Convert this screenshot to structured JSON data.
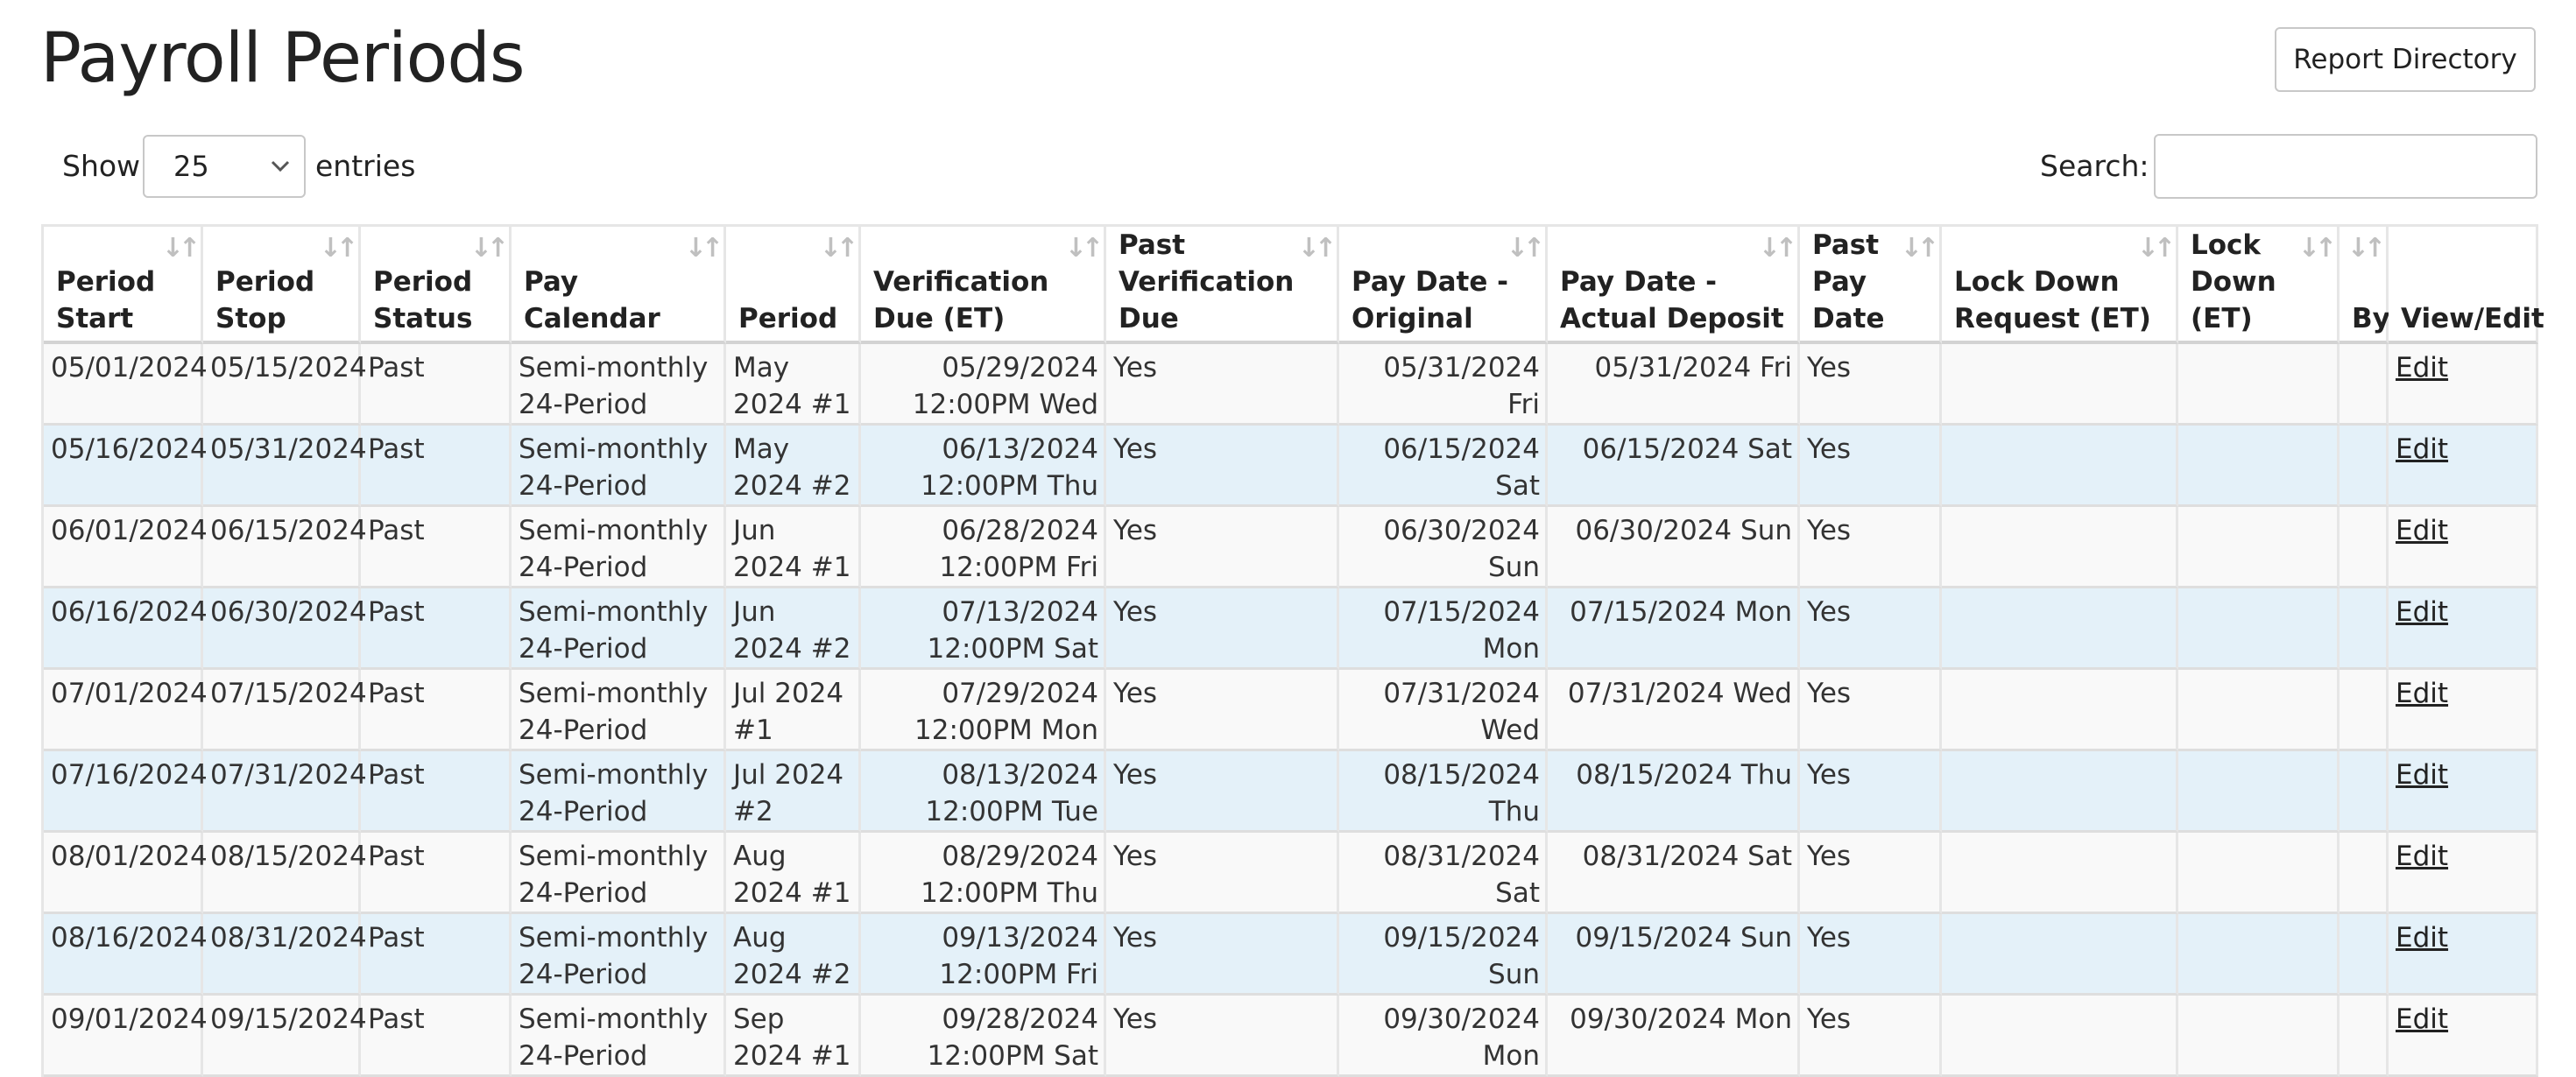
{
  "page": {
    "title": "Payroll Periods",
    "report_button": "Report Directory"
  },
  "length_menu": {
    "show": "Show",
    "value": "25",
    "entries": "entries"
  },
  "search": {
    "label": "Search:",
    "value": ""
  },
  "columns": [
    "Period Start",
    "Period Stop",
    "Period Status",
    "Pay Calendar",
    "Period",
    "Verification Due (ET)",
    "Past Verification Due",
    "Pay Date - Original",
    "Pay Date - Actual Deposit",
    "Past Pay Date",
    "Lock Down Request (ET)",
    "Lock Down (ET)",
    "By",
    "View/Edit"
  ],
  "rows": [
    {
      "start": "05/01/2024",
      "stop": "05/15/2024",
      "status": "Past",
      "calendar": "Semi-monthly 24-Period",
      "period": "May 2024 #1",
      "verify_date": "05/29/2024",
      "verify_time": "12:00PM Wed",
      "past_verify": "Yes",
      "pay_orig": "05/31/2024 Fri",
      "pay_actual": "05/31/2024 Fri",
      "past_pay": "Yes",
      "lock_req": "",
      "lock": "",
      "by": "",
      "action": "Edit"
    },
    {
      "start": "05/16/2024",
      "stop": "05/31/2024",
      "status": "Past",
      "calendar": "Semi-monthly 24-Period",
      "period": "May 2024 #2",
      "verify_date": "06/13/2024",
      "verify_time": "12:00PM Thu",
      "past_verify": "Yes",
      "pay_orig": "06/15/2024 Sat",
      "pay_actual": "06/15/2024 Sat",
      "past_pay": "Yes",
      "lock_req": "",
      "lock": "",
      "by": "",
      "action": "Edit"
    },
    {
      "start": "06/01/2024",
      "stop": "06/15/2024",
      "status": "Past",
      "calendar": "Semi-monthly 24-Period",
      "period": "Jun 2024 #1",
      "verify_date": "06/28/2024",
      "verify_time": "12:00PM Fri",
      "past_verify": "Yes",
      "pay_orig": "06/30/2024 Sun",
      "pay_actual": "06/30/2024 Sun",
      "past_pay": "Yes",
      "lock_req": "",
      "lock": "",
      "by": "",
      "action": "Edit"
    },
    {
      "start": "06/16/2024",
      "stop": "06/30/2024",
      "status": "Past",
      "calendar": "Semi-monthly 24-Period",
      "period": "Jun 2024 #2",
      "verify_date": "07/13/2024",
      "verify_time": "12:00PM Sat",
      "past_verify": "Yes",
      "pay_orig": "07/15/2024 Mon",
      "pay_actual": "07/15/2024 Mon",
      "past_pay": "Yes",
      "lock_req": "",
      "lock": "",
      "by": "",
      "action": "Edit"
    },
    {
      "start": "07/01/2024",
      "stop": "07/15/2024",
      "status": "Past",
      "calendar": "Semi-monthly 24-Period",
      "period": "Jul 2024 #1",
      "verify_date": "07/29/2024",
      "verify_time": "12:00PM Mon",
      "past_verify": "Yes",
      "pay_orig": "07/31/2024 Wed",
      "pay_actual": "07/31/2024 Wed",
      "past_pay": "Yes",
      "lock_req": "",
      "lock": "",
      "by": "",
      "action": "Edit"
    },
    {
      "start": "07/16/2024",
      "stop": "07/31/2024",
      "status": "Past",
      "calendar": "Semi-monthly 24-Period",
      "period": "Jul 2024 #2",
      "verify_date": "08/13/2024",
      "verify_time": "12:00PM Tue",
      "past_verify": "Yes",
      "pay_orig": "08/15/2024 Thu",
      "pay_actual": "08/15/2024 Thu",
      "past_pay": "Yes",
      "lock_req": "",
      "lock": "",
      "by": "",
      "action": "Edit"
    },
    {
      "start": "08/01/2024",
      "stop": "08/15/2024",
      "status": "Past",
      "calendar": "Semi-monthly 24-Period",
      "period": "Aug 2024 #1",
      "verify_date": "08/29/2024",
      "verify_time": "12:00PM Thu",
      "past_verify": "Yes",
      "pay_orig": "08/31/2024 Sat",
      "pay_actual": "08/31/2024 Sat",
      "past_pay": "Yes",
      "lock_req": "",
      "lock": "",
      "by": "",
      "action": "Edit"
    },
    {
      "start": "08/16/2024",
      "stop": "08/31/2024",
      "status": "Past",
      "calendar": "Semi-monthly 24-Period",
      "period": "Aug 2024 #2",
      "verify_date": "09/13/2024",
      "verify_time": "12:00PM Fri",
      "past_verify": "Yes",
      "pay_orig": "09/15/2024 Sun",
      "pay_actual": "09/15/2024 Sun",
      "past_pay": "Yes",
      "lock_req": "",
      "lock": "",
      "by": "",
      "action": "Edit"
    },
    {
      "start": "09/01/2024",
      "stop": "09/15/2024",
      "status": "Past",
      "calendar": "Semi-monthly 24-Period",
      "period": "Sep 2024 #1",
      "verify_date": "09/28/2024",
      "verify_time": "12:00PM Sat",
      "past_verify": "Yes",
      "pay_orig": "09/30/2024 Mon",
      "pay_actual": "09/30/2024 Mon",
      "past_pay": "Yes",
      "lock_req": "",
      "lock": "",
      "by": "",
      "action": "Edit"
    }
  ]
}
